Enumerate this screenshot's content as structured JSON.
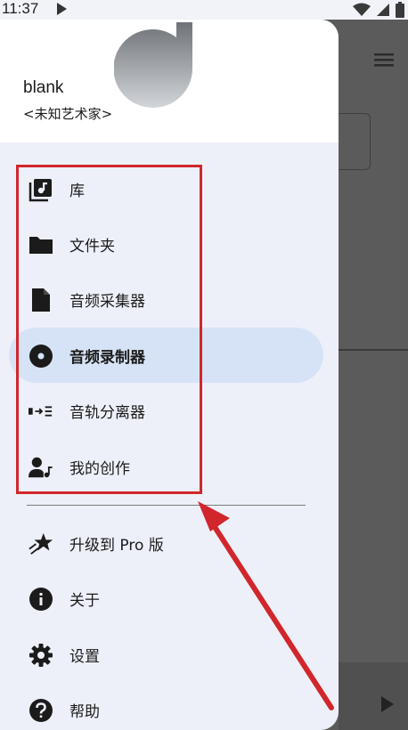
{
  "status_bar": {
    "time": "11:37"
  },
  "drawer": {
    "artist_name": "blank",
    "artist_sub": "<未知艺术家>",
    "items": [
      {
        "label": "库",
        "icon": "library-music-icon"
      },
      {
        "label": "文件夹",
        "icon": "folder-icon"
      },
      {
        "label": "音频采集器",
        "icon": "file-icon"
      },
      {
        "label": "音频录制器",
        "icon": "record-disc-icon",
        "active": true
      },
      {
        "label": "音轨分离器",
        "icon": "track-split-icon"
      },
      {
        "label": "我的创作",
        "icon": "person-music-icon"
      }
    ],
    "bottom_items": [
      {
        "label": "升级到 Pro 版",
        "icon": "star-upgrade-icon"
      },
      {
        "label": "关于",
        "icon": "info-icon"
      },
      {
        "label": "设置",
        "icon": "gear-icon"
      },
      {
        "label": "帮助",
        "icon": "help-icon"
      }
    ]
  },
  "colors": {
    "drawer_bg": "#edf0f9",
    "active_item_bg": "#d6e3f6",
    "highlight_red": "#d1262b",
    "background_app": "#5b5b5b"
  }
}
